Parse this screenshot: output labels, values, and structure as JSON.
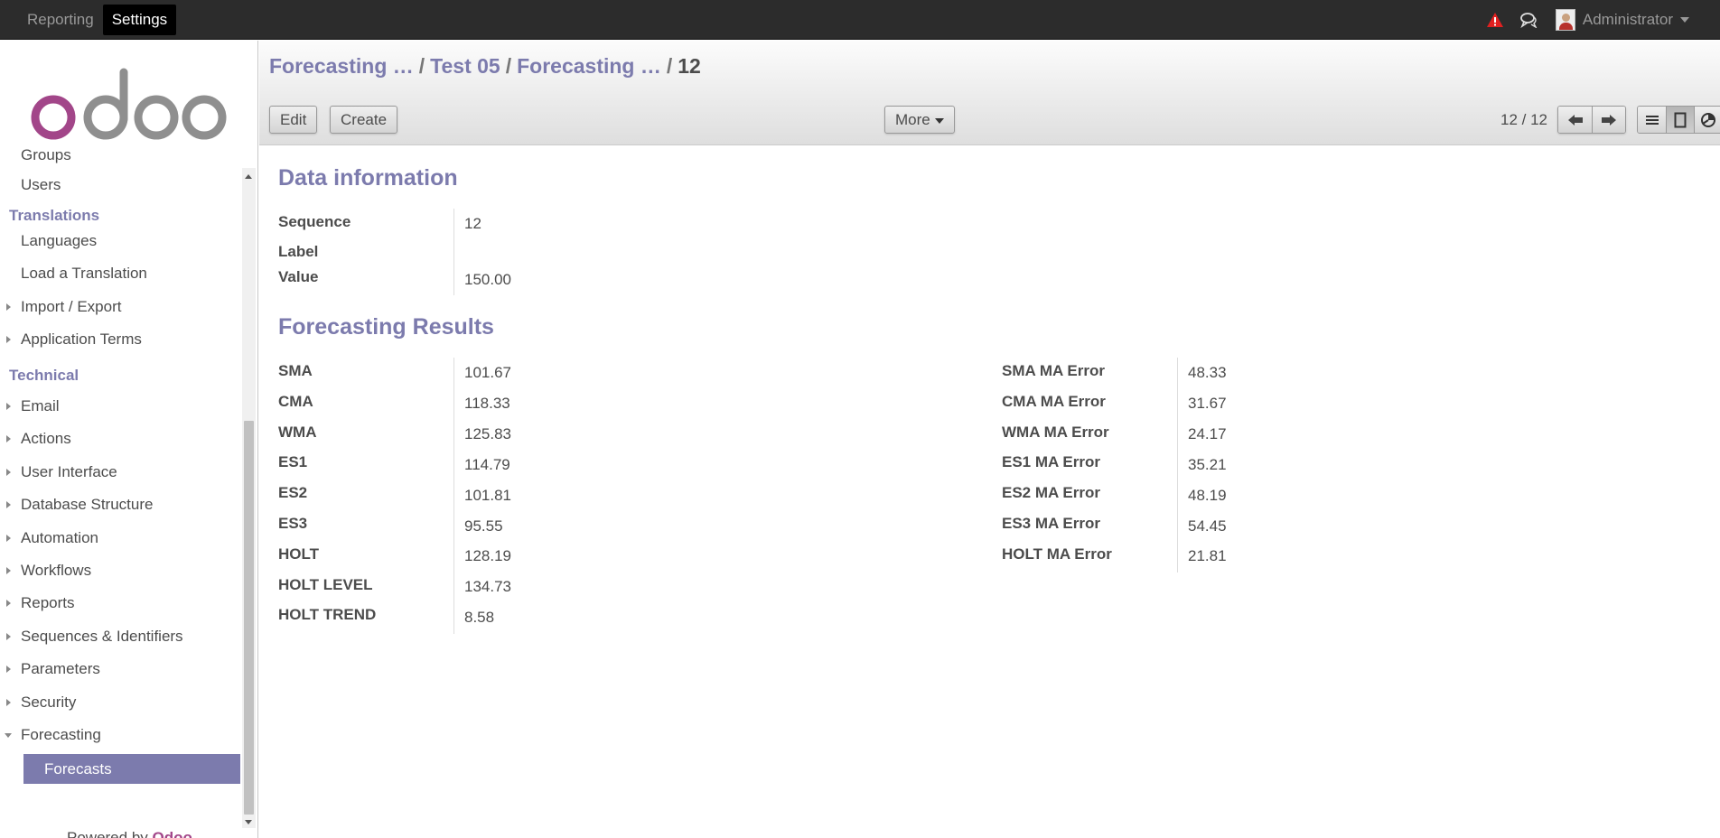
{
  "topbar": {
    "menu": [
      "Reporting",
      "Settings"
    ],
    "active_menu": "Settings",
    "user": "Administrator"
  },
  "sidebar": {
    "items_top": [
      "Groups",
      "Users"
    ],
    "translations_section": "Translations",
    "translations_items": [
      "Languages",
      "Load a Translation",
      "Import / Export",
      "Application Terms"
    ],
    "technical_section": "Technical",
    "technical_items": [
      "Email",
      "Actions",
      "User Interface",
      "Database Structure",
      "Automation",
      "Workflows",
      "Reports",
      "Sequences & Identifiers",
      "Parameters",
      "Security",
      "Forecasting"
    ],
    "selected_item": "Forecasts",
    "powered_by": "Powered by",
    "brand": "Odoo"
  },
  "breadcrumb": {
    "items": [
      "Forecasting …",
      "Test 05",
      "Forecasting …"
    ],
    "current": "12"
  },
  "toolbar": {
    "edit": "Edit",
    "create": "Create",
    "more": "More",
    "pager": "12 / 12"
  },
  "form": {
    "data_info_title": "Data information",
    "data_fields": [
      {
        "label": "Sequence",
        "value": "12"
      },
      {
        "label": "Label",
        "value": ""
      },
      {
        "label": "Value",
        "value": "150.00"
      }
    ],
    "results_title": "Forecasting Results",
    "results_left": [
      {
        "label": "SMA",
        "value": "101.67"
      },
      {
        "label": "CMA",
        "value": "118.33"
      },
      {
        "label": "WMA",
        "value": "125.83"
      },
      {
        "label": "ES1",
        "value": "114.79"
      },
      {
        "label": "ES2",
        "value": "101.81"
      },
      {
        "label": "ES3",
        "value": "95.55"
      },
      {
        "label": "HOLT",
        "value": "128.19"
      },
      {
        "label": "HOLT LEVEL",
        "value": "134.73"
      },
      {
        "label": "HOLT TREND",
        "value": "8.58"
      }
    ],
    "results_right": [
      {
        "label": "SMA MA Error",
        "value": "48.33"
      },
      {
        "label": "CMA MA Error",
        "value": "31.67"
      },
      {
        "label": "WMA MA Error",
        "value": "24.17"
      },
      {
        "label": "ES1 MA Error",
        "value": "35.21"
      },
      {
        "label": "ES2 MA Error",
        "value": "48.19"
      },
      {
        "label": "ES3 MA Error",
        "value": "54.45"
      },
      {
        "label": "HOLT MA Error",
        "value": "21.81"
      }
    ]
  },
  "colors": {
    "accent": "#7c7bad",
    "brand": "#a24689",
    "topbar": "#2c2c2c"
  }
}
